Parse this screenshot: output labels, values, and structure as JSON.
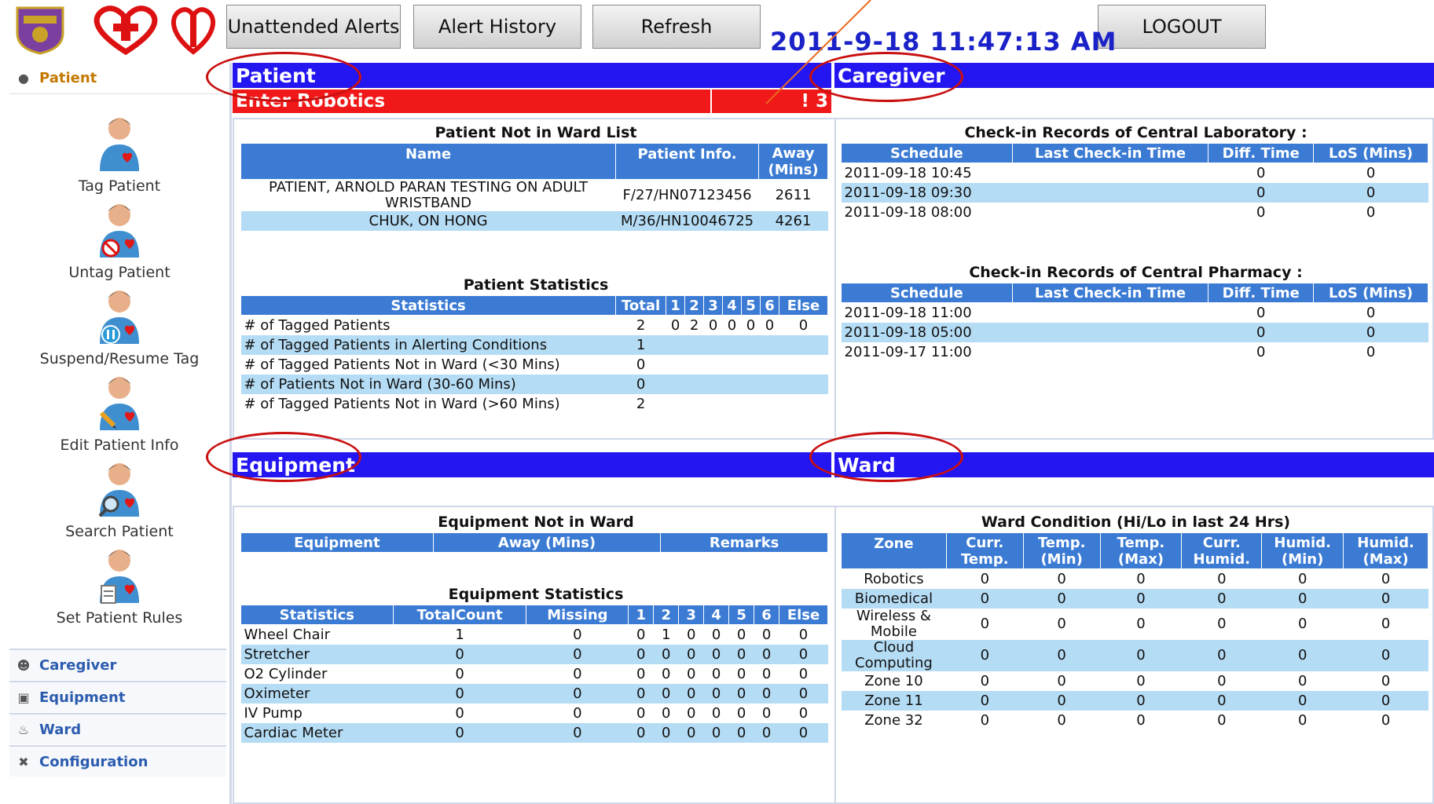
{
  "topbar": {
    "buttons": [
      "Unattended Alerts",
      "Alert History",
      "Refresh",
      "LOGOUT"
    ],
    "datetime": "2011-9-18 11:47:13 AM"
  },
  "sidebar": {
    "active_section": "Patient",
    "items": [
      "Tag Patient",
      "Untag Patient",
      "Suspend/Resume Tag",
      "Edit Patient Info",
      "Search Patient",
      "Set Patient Rules"
    ],
    "sections": [
      "Caregiver",
      "Equipment",
      "Ward",
      "Configuration"
    ]
  },
  "headers": {
    "patient": "Patient",
    "caregiver": "Caregiver",
    "equipment": "Equipment",
    "ward": "Ward"
  },
  "alert_bar": {
    "label": "Enter Robotics",
    "count": "! 3"
  },
  "patient_not_in_ward": {
    "title": "Patient Not in Ward List",
    "columns": [
      "Name",
      "Patient Info.",
      "Away (Mins)"
    ],
    "rows": [
      [
        "PATIENT, ARNOLD PARAN TESTING ON ADULT WRISTBAND",
        "F/27/HN07123456",
        "2611"
      ],
      [
        "CHUK, ON HONG",
        "M/36/HN10046725",
        "4261"
      ]
    ]
  },
  "patient_stats": {
    "title": "Patient Statistics",
    "columns": [
      "Statistics",
      "Total",
      "1",
      "2",
      "3",
      "4",
      "5",
      "6",
      "Else"
    ],
    "rows": [
      [
        "# of Tagged Patients",
        "2",
        "0",
        "2",
        "0",
        "0",
        "0",
        "0",
        "0"
      ],
      [
        "# of Tagged Patients in Alerting Conditions",
        "1",
        "",
        "",
        "",
        "",
        "",
        "",
        ""
      ],
      [
        "# of Tagged Patients Not in Ward (<30 Mins)",
        "0",
        "",
        "",
        "",
        "",
        "",
        "",
        ""
      ],
      [
        "# of Patients Not in Ward (30-60 Mins)",
        "0",
        "",
        "",
        "",
        "",
        "",
        "",
        ""
      ],
      [
        "# of Tagged Patients Not in Ward (>60 Mins)",
        "2",
        "",
        "",
        "",
        "",
        "",
        "",
        ""
      ]
    ]
  },
  "lab": {
    "title": "Check-in Records of Central Laboratory :",
    "columns": [
      "Schedule",
      "Last Check-in Time",
      "Diff. Time",
      "LoS (Mins)"
    ],
    "rows": [
      [
        "2011-09-18 10:45",
        "",
        "0",
        "0"
      ],
      [
        "2011-09-18 09:30",
        "",
        "0",
        "0"
      ],
      [
        "2011-09-18 08:00",
        "",
        "0",
        "0"
      ]
    ]
  },
  "pharmacy": {
    "title": "Check-in Records of Central Pharmacy :",
    "columns": [
      "Schedule",
      "Last Check-in Time",
      "Diff. Time",
      "LoS (Mins)"
    ],
    "rows": [
      [
        "2011-09-18 11:00",
        "",
        "0",
        "0"
      ],
      [
        "2011-09-18 05:00",
        "",
        "0",
        "0"
      ],
      [
        "2011-09-17 11:00",
        "",
        "0",
        "0"
      ]
    ]
  },
  "equip_not_in_ward": {
    "title": "Equipment Not in Ward",
    "columns": [
      "Equipment",
      "Away (Mins)",
      "Remarks"
    ]
  },
  "equip_stats": {
    "title": "Equipment Statistics",
    "columns": [
      "Statistics",
      "TotalCount",
      "Missing",
      "1",
      "2",
      "3",
      "4",
      "5",
      "6",
      "Else"
    ],
    "rows": [
      [
        "Wheel Chair",
        "1",
        "0",
        "0",
        "1",
        "0",
        "0",
        "0",
        "0",
        "0"
      ],
      [
        "Stretcher",
        "0",
        "0",
        "0",
        "0",
        "0",
        "0",
        "0",
        "0",
        "0"
      ],
      [
        "O2 Cylinder",
        "0",
        "0",
        "0",
        "0",
        "0",
        "0",
        "0",
        "0",
        "0"
      ],
      [
        "Oximeter",
        "0",
        "0",
        "0",
        "0",
        "0",
        "0",
        "0",
        "0",
        "0"
      ],
      [
        "IV Pump",
        "0",
        "0",
        "0",
        "0",
        "0",
        "0",
        "0",
        "0",
        "0"
      ],
      [
        "Cardiac Meter",
        "0",
        "0",
        "0",
        "0",
        "0",
        "0",
        "0",
        "0",
        "0"
      ]
    ]
  },
  "ward_condition": {
    "title": "Ward Condition (Hi/Lo in last 24 Hrs)",
    "columns": [
      "Zone",
      "Curr. Temp.",
      "Temp. (Min)",
      "Temp. (Max)",
      "Curr. Humid.",
      "Humid. (Min)",
      "Humid. (Max)"
    ],
    "rows": [
      [
        "Robotics",
        "0",
        "0",
        "0",
        "0",
        "0",
        "0"
      ],
      [
        "Biomedical",
        "0",
        "0",
        "0",
        "0",
        "0",
        "0"
      ],
      [
        "Wireless & Mobile",
        "0",
        "0",
        "0",
        "0",
        "0",
        "0"
      ],
      [
        "Cloud Computing",
        "0",
        "0",
        "0",
        "0",
        "0",
        "0"
      ],
      [
        "Zone 10",
        "0",
        "0",
        "0",
        "0",
        "0",
        "0"
      ],
      [
        "Zone 11",
        "0",
        "0",
        "0",
        "0",
        "0",
        "0"
      ],
      [
        "Zone 32",
        "0",
        "0",
        "0",
        "0",
        "0",
        "0"
      ]
    ]
  }
}
